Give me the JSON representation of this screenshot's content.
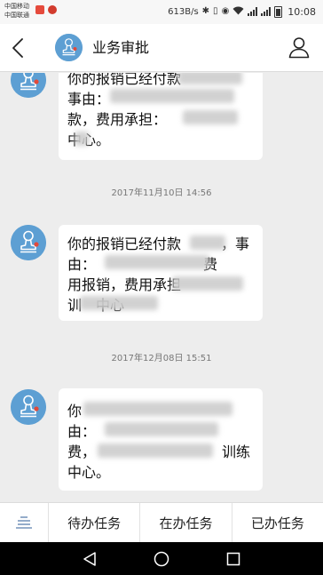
{
  "status_bar": {
    "carrier_1": "中国移动",
    "carrier_2": "中国联通",
    "network_speed": "613B/s",
    "time": "10:08",
    "icons": [
      "bluetooth-icon",
      "vibrate-icon",
      "eye-icon",
      "wifi-icon",
      "signal-icon",
      "battery-icon"
    ]
  },
  "header": {
    "title": "业务审批",
    "back_icon": "chevron-left-icon",
    "user_icon": "person-icon"
  },
  "messages": [
    {
      "text_lines": [
        "你的报销已经付款",
        "事由：",
        "款，费用承担：",
        "中心。"
      ]
    },
    {
      "timestamp": "2017年11月10日 14:56",
      "text_lines": [
        "你的报销已经付款",
        "，事",
        "由：",
        "费",
        "用报销，费用承担",
        "训",
        "中心"
      ]
    },
    {
      "timestamp": "2017年12月08日 15:51",
      "text_lines": [
        "你",
        "由：",
        "费，",
        "训练",
        "中心。"
      ]
    }
  ],
  "tab_bar": {
    "menu_icon": "menu-icon",
    "tabs": [
      {
        "label": "待办任务"
      },
      {
        "label": "在办任务"
      },
      {
        "label": "已办任务"
      }
    ]
  },
  "nav_bar": {
    "icons": [
      "back-triangle-icon",
      "home-circle-icon",
      "recents-square-icon"
    ]
  },
  "colors": {
    "accent_blue": "#5d9fd3",
    "background": "#ededed",
    "bubble": "#ffffff"
  }
}
